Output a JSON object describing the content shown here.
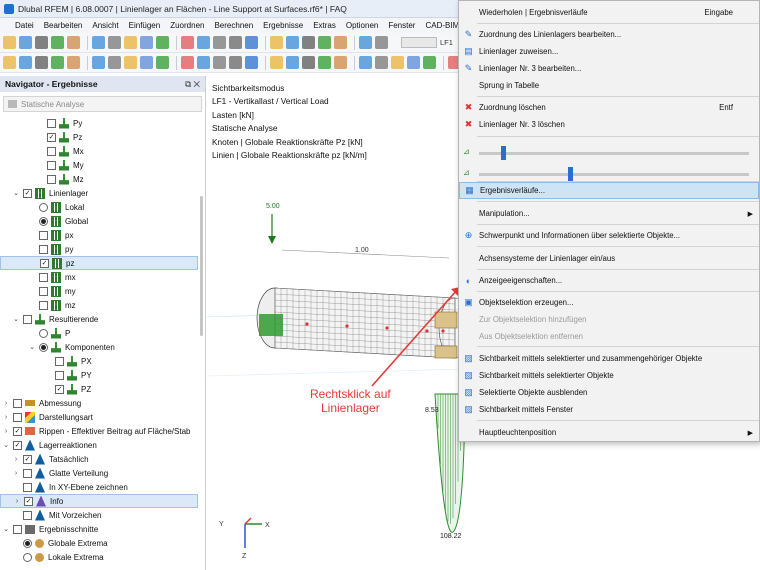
{
  "window": {
    "title": "Dlubal RFEM | 6.08.0007 | Linienlager an Flächen - Line Support at Surfaces.rf6* | FAQ"
  },
  "menu": [
    "Datei",
    "Bearbeiten",
    "Ansicht",
    "Einfügen",
    "Zuordnen",
    "Berechnen",
    "Ergebnisse",
    "Extras",
    "Optionen",
    "Fenster",
    "CAD-BIM",
    "Hilfe"
  ],
  "toolbar": {
    "load_case": "LF1"
  },
  "navigator": {
    "title": "Navigator - Ergebnisse",
    "controls": "⧉ ✕",
    "analysis": "Statische Analyse",
    "rows": [
      {
        "label": "Py",
        "indent": 36,
        "ctl": "cb",
        "checked": false,
        "icon": "green",
        "icon_name": "force-py-icon"
      },
      {
        "label": "Pz",
        "indent": 36,
        "ctl": "cb",
        "checked": true,
        "icon": "green",
        "icon_name": "force-pz-icon"
      },
      {
        "label": "Mx",
        "indent": 36,
        "ctl": "cb",
        "checked": false,
        "icon": "green",
        "icon_name": "moment-mx-icon"
      },
      {
        "label": "My",
        "indent": 36,
        "ctl": "cb",
        "checked": false,
        "icon": "green",
        "icon_name": "moment-my-icon"
      },
      {
        "label": "Mz",
        "indent": 36,
        "ctl": "cb",
        "checked": false,
        "icon": "green",
        "icon_name": "moment-mz-icon"
      },
      {
        "label": "Linienlager",
        "indent": 12,
        "exp": "⌄",
        "ctl": "cb",
        "checked": true,
        "icon": "hatch",
        "icon_name": "line-support-icon"
      },
      {
        "label": "Lokal",
        "indent": 28,
        "ctl": "rb",
        "checked": false,
        "icon": "hatch",
        "icon_name": "local-icon"
      },
      {
        "label": "Global",
        "indent": 28,
        "ctl": "rb",
        "checked": true,
        "icon": "hatch",
        "icon_name": "global-icon"
      },
      {
        "label": "px",
        "indent": 28,
        "ctl": "cb",
        "checked": false,
        "icon": "hatch",
        "icon_name": "force-px-icon"
      },
      {
        "label": "py",
        "indent": 28,
        "ctl": "cb",
        "checked": false,
        "icon": "hatch",
        "icon_name": "force-py-line-icon"
      },
      {
        "label": "pz",
        "indent": 28,
        "ctl": "cb",
        "checked": true,
        "icon": "hatch",
        "icon_name": "force-pz-line-icon",
        "selected": true
      },
      {
        "label": "mx",
        "indent": 28,
        "ctl": "cb",
        "checked": false,
        "icon": "hatch",
        "icon_name": "moment-mx-line-icon"
      },
      {
        "label": "my",
        "indent": 28,
        "ctl": "cb",
        "checked": false,
        "icon": "hatch",
        "icon_name": "moment-my-line-icon"
      },
      {
        "label": "mz",
        "indent": 28,
        "ctl": "cb",
        "checked": false,
        "icon": "hatch",
        "icon_name": "moment-mz-line-icon"
      },
      {
        "label": "Resultierende",
        "indent": 12,
        "exp": "⌄",
        "ctl": "cb",
        "checked": false,
        "icon": "green",
        "icon_name": "resultant-icon"
      },
      {
        "label": "P",
        "indent": 28,
        "ctl": "rb",
        "checked": false,
        "icon": "green",
        "icon_name": "resultant-p-icon"
      },
      {
        "label": "Komponenten",
        "indent": 28,
        "exp": "⌄",
        "ctl": "rb",
        "checked": true,
        "icon": "green",
        "icon_name": "components-icon"
      },
      {
        "label": "PX",
        "indent": 44,
        "ctl": "cb",
        "checked": false,
        "icon": "green",
        "icon_name": "component-px-icon"
      },
      {
        "label": "PY",
        "indent": 44,
        "ctl": "cb",
        "checked": false,
        "icon": "green",
        "icon_name": "component-py-icon"
      },
      {
        "label": "PZ",
        "indent": 44,
        "ctl": "cb",
        "checked": true,
        "icon": "green",
        "icon_name": "component-pz-icon"
      },
      {
        "label": "Abmessung",
        "indent": 2,
        "exp": "›",
        "ctl": "cb",
        "checked": false,
        "icon": "ruler",
        "icon_name": "dimension-icon"
      },
      {
        "label": "Darstellungsart",
        "indent": 2,
        "exp": "›",
        "ctl": "cb",
        "checked": false,
        "icon": "palette",
        "icon_name": "display-type-icon"
      },
      {
        "label": "Rippen - Effektiver Beitrag auf Fläche/Stab",
        "indent": 2,
        "exp": "›",
        "ctl": "cb",
        "checked": true,
        "icon": "rib",
        "icon_name": "rib-icon"
      },
      {
        "label": "Lagerreaktionen",
        "indent": 2,
        "exp": "⌄",
        "ctl": "cb",
        "checked": true,
        "icon": "support",
        "icon_name": "support-reactions-icon"
      },
      {
        "label": "Tatsächlich",
        "indent": 12,
        "exp": "›",
        "ctl": "cb",
        "checked": true,
        "icon": "support",
        "icon_name": "actual-icon"
      },
      {
        "label": "Glatte Verteilung",
        "indent": 12,
        "exp": "›",
        "ctl": "cb",
        "checked": false,
        "icon": "support",
        "icon_name": "smooth-distribution-icon"
      },
      {
        "label": "In XY-Ebene zeichnen",
        "indent": 12,
        "exp": "",
        "ctl": "cb",
        "checked": false,
        "icon": "support",
        "icon_name": "xy-plane-icon"
      },
      {
        "label": "Info",
        "indent": 12,
        "exp": "›",
        "ctl": "cb",
        "checked": true,
        "icon": "info",
        "icon_name": "info-icon",
        "selected": true
      },
      {
        "label": "Mit Vorzeichen",
        "indent": 12,
        "exp": "",
        "ctl": "cb",
        "checked": false,
        "icon": "support",
        "icon_name": "with-sign-icon"
      },
      {
        "label": "Ergebnisschnitte",
        "indent": 2,
        "exp": "⌄",
        "ctl": "cb",
        "checked": false,
        "icon": "stats",
        "icon_name": "result-sections-icon"
      },
      {
        "label": "Globale Extrema",
        "indent": 12,
        "exp": "",
        "ctl": "rb",
        "checked": true,
        "icon": "globe",
        "icon_name": "global-extrema-icon"
      },
      {
        "label": "Lokale Extrema",
        "indent": 12,
        "exp": "",
        "ctl": "rb",
        "checked": false,
        "icon": "globe",
        "icon_name": "local-extrema-icon"
      }
    ]
  },
  "viewport": {
    "info_lines": [
      "Sichtbarkeitsmodus",
      "LF1 - Vertikallast / Vertical Load",
      "Lasten [kN]",
      "Statische Analyse",
      "Knoten | Globale Reaktionskräfte Pz [kN]",
      "Linien | Globale Reaktionskräfte pz [kN/m]"
    ],
    "load_value": "5.00",
    "dim_value": "1.00",
    "diagram_top_value": "8.53",
    "diagram_bottom_value": "108.22",
    "axes": {
      "x": "X",
      "y": "Y",
      "z": "Z"
    },
    "callout": [
      "Rechtsklick auf",
      "Linienlager"
    ],
    "colors": {
      "mesh": "#555555",
      "green": "#2e8b2e",
      "red": "#e23a3a",
      "highlight": "#cde4f7"
    }
  },
  "context_menu": {
    "items": [
      {
        "label": "Wiederholen | Ergebnisverläufe",
        "key": "Eingabe",
        "icon": "",
        "icon_name": "repeat-icon"
      },
      {
        "label": "Zuordnung des Linienlagers bearbeiten...",
        "key": "",
        "icon": "✎",
        "icon_name": "edit-assignment-icon"
      },
      {
        "label": "Linienlager zuweisen...",
        "key": "",
        "icon": "▤",
        "icon_name": "assign-support-icon"
      },
      {
        "label": "Linienlager Nr. 3 bearbeiten...",
        "key": "",
        "icon": "✎",
        "icon_name": "edit-support-icon"
      },
      {
        "label": "Sprung in Tabelle",
        "key": "",
        "icon": "",
        "icon_name": "jump-table-icon"
      },
      {
        "label": "Zuordnung löschen",
        "key": "Entf",
        "icon": "✖",
        "icon_name": "delete-assignment-icon"
      },
      {
        "label": "Linienlager Nr. 3 löschen",
        "key": "",
        "icon": "✖",
        "icon_name": "delete-support-icon"
      },
      {
        "label": "Ergebnisverläufe...",
        "key": "",
        "icon": "▦",
        "icon_name": "result-diagrams-icon",
        "highlight": true
      },
      {
        "label": "Manipulation...",
        "key": "",
        "icon": "",
        "icon_name": "manipulation-icon",
        "submenu": true
      },
      {
        "label": "Schwerpunkt und Informationen über selektierte Objekte...",
        "key": "",
        "icon": "⊕",
        "icon_name": "centroid-icon"
      },
      {
        "label": "Achsensysteme der Linienlager ein/aus",
        "key": "",
        "icon": "",
        "icon_name": "axis-systems-icon"
      },
      {
        "label": "Anzeigeeigenschaften...",
        "key": "",
        "icon": "◐",
        "icon_name": "display-properties-icon"
      },
      {
        "label": "Objektselektion erzeugen...",
        "key": "",
        "icon": "▣",
        "icon_name": "create-selection-icon"
      },
      {
        "label": "Zur Objektselektion hinzufügen",
        "key": "",
        "icon": "",
        "icon_name": "add-selection-icon",
        "disabled": true
      },
      {
        "label": "Aus Objektselektion entfernen",
        "key": "",
        "icon": "",
        "icon_name": "remove-selection-icon",
        "disabled": true
      },
      {
        "label": "Sichtbarkeit mittels selektierter und zusammengehöriger Objekte",
        "key": "",
        "icon": "▨",
        "icon_name": "visibility-related-icon"
      },
      {
        "label": "Sichtbarkeit mittels selektierter Objekte",
        "key": "",
        "icon": "▨",
        "icon_name": "visibility-selected-icon"
      },
      {
        "label": "Selektierte Objekte ausblenden",
        "key": "",
        "icon": "▨",
        "icon_name": "hide-selected-icon"
      },
      {
        "label": "Sichtbarkeit mittels Fenster",
        "key": "",
        "icon": "▨",
        "icon_name": "visibility-window-icon"
      },
      {
        "label": "Hauptleuchtenposition",
        "key": "",
        "icon": "",
        "icon_name": "main-light-icon",
        "submenu": true
      }
    ],
    "slider_values": [
      0.08,
      0.33
    ]
  }
}
